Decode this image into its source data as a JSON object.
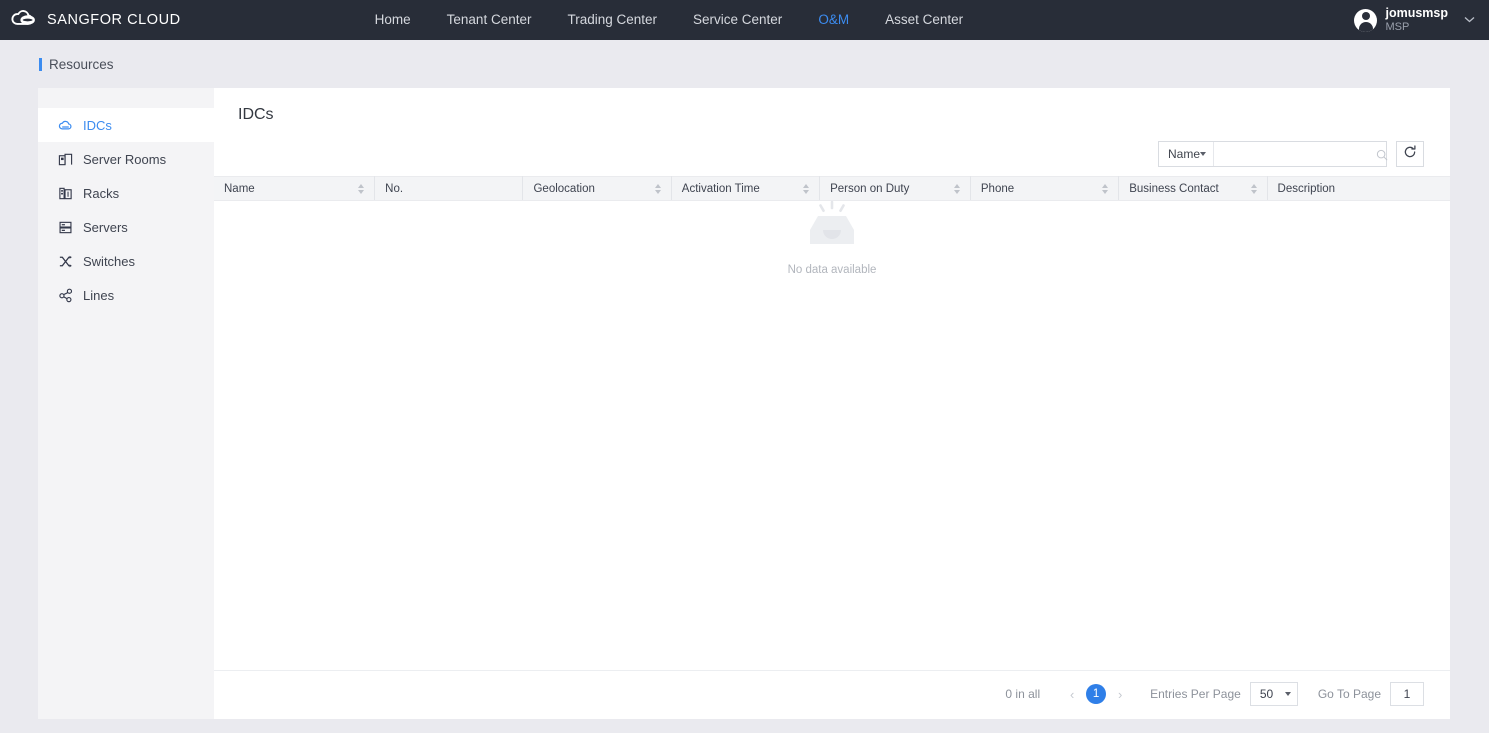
{
  "topbar": {
    "brand": "SANGFOR CLOUD",
    "logo_icon": "cloud-logo-icon",
    "nav": [
      {
        "label": "Home",
        "active": false
      },
      {
        "label": "Tenant Center",
        "active": false
      },
      {
        "label": "Trading Center",
        "active": false
      },
      {
        "label": "Service Center",
        "active": false
      },
      {
        "label": "O&M",
        "active": true
      },
      {
        "label": "Asset Center",
        "active": false
      }
    ],
    "user": {
      "name": "jomusmsp",
      "role": "MSP",
      "caret": "⌄"
    },
    "accent_color": "#3c8cf0",
    "background_color": "#282d38"
  },
  "breadcrumb": {
    "label": "Resources"
  },
  "sidebar": {
    "items": [
      {
        "label": "IDCs",
        "icon": "cloud-icon",
        "active": true
      },
      {
        "label": "Server Rooms",
        "icon": "server-room-icon",
        "active": false
      },
      {
        "label": "Racks",
        "icon": "rack-icon",
        "active": false
      },
      {
        "label": "Servers",
        "icon": "server-icon",
        "active": false
      },
      {
        "label": "Switches",
        "icon": "switch-icon",
        "active": false
      },
      {
        "label": "Lines",
        "icon": "lines-icon",
        "active": false
      }
    ]
  },
  "main": {
    "title": "IDCs",
    "search": {
      "field_label": "Name",
      "value": "",
      "placeholder": "",
      "search_icon": "magnifier-icon",
      "refresh_icon": "refresh-icon"
    },
    "table": {
      "columns": [
        {
          "label": "Name",
          "sortable": true
        },
        {
          "label": "No.",
          "sortable": false
        },
        {
          "label": "Geolocation",
          "sortable": true
        },
        {
          "label": "Activation Time",
          "sortable": true
        },
        {
          "label": "Person on Duty",
          "sortable": true
        },
        {
          "label": "Phone",
          "sortable": true
        },
        {
          "label": "Business Contact",
          "sortable": true
        },
        {
          "label": "Description",
          "sortable": false
        }
      ],
      "rows": [],
      "empty_text": "No data available",
      "empty_icon": "empty-inbox-icon"
    },
    "pagination": {
      "total_text": "0 in all",
      "prev_icon": "‹",
      "next_icon": "›",
      "current_page": "1",
      "entries_label": "Entries Per Page",
      "entries_value": "50",
      "goto_label": "Go To Page",
      "goto_value": "1",
      "active_color": "#2f7fe8"
    }
  }
}
